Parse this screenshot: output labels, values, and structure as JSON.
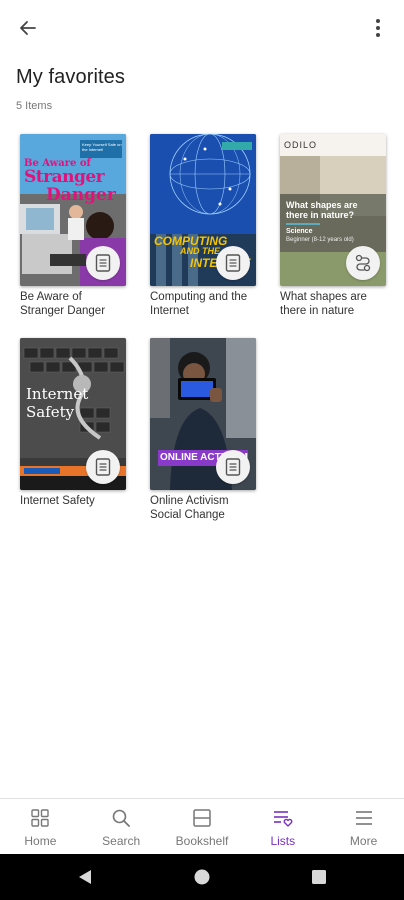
{
  "header": {
    "back_icon": "arrow-left-icon",
    "menu_icon": "more-vertical-icon"
  },
  "page": {
    "title": "My favorites",
    "count": "5 Items"
  },
  "books": [
    {
      "caption": "Be Aware of Stranger Danger",
      "cover_line1": "Be Aware of",
      "cover_line2": "Stranger",
      "cover_line3": "Danger",
      "cover_tag": "Keep Yourself Safe on the Internet!",
      "type_icon": "document-icon"
    },
    {
      "caption": "Computing and the Internet",
      "cover_line1": "COMPUTING",
      "cover_line2": "AND THE",
      "cover_line3": "INTERNET",
      "type_icon": "document-icon"
    },
    {
      "caption": "What shapes are there in nature",
      "cover_brand": "ODILO",
      "cover_title": "What shapes are there in nature?",
      "cover_subject": "Science",
      "cover_level": "Beginner (8-12 years old)",
      "type_icon": "path-icon"
    },
    {
      "caption": "Internet Safety",
      "cover_line1": "Internet",
      "cover_line2": "Safety",
      "type_icon": "document-icon"
    },
    {
      "caption": "Online Activism Social Change",
      "cover_line1": "ONLINE ACTIVISM",
      "type_icon": "document-icon"
    }
  ],
  "bottom_nav": [
    {
      "label": "Home",
      "icon": "home-grid-icon",
      "active": false
    },
    {
      "label": "Search",
      "icon": "search-icon",
      "active": false
    },
    {
      "label": "Bookshelf",
      "icon": "bookshelf-icon",
      "active": false
    },
    {
      "label": "Lists",
      "icon": "list-heart-icon",
      "active": true
    },
    {
      "label": "More",
      "icon": "hamburger-menu-icon",
      "active": false
    }
  ],
  "colors": {
    "accent": "#7b2fbf",
    "text": "#222222",
    "muted": "#777777"
  }
}
